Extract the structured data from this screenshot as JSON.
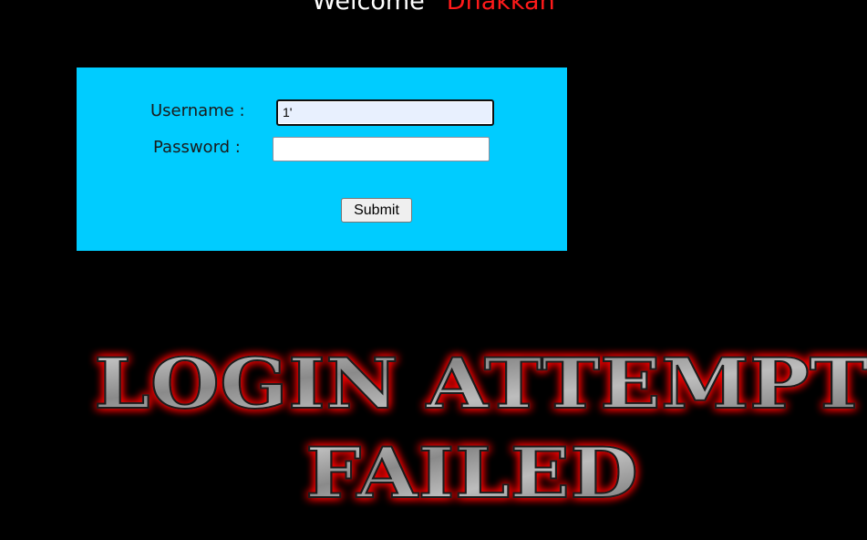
{
  "header": {
    "welcome_prefix": "Welcome",
    "username_display": "Dhakkan"
  },
  "login_form": {
    "username_label": "Username :",
    "password_label": "Password :",
    "username_value": "1'",
    "password_value": "",
    "submit_label": "Submit",
    "panel_color": "#00ccff"
  },
  "result_banner": {
    "line1": "LOGIN ATTEMPT",
    "line2": "FAILED",
    "text_color": "#8a8a8a",
    "glow_color": "#ff0000"
  }
}
